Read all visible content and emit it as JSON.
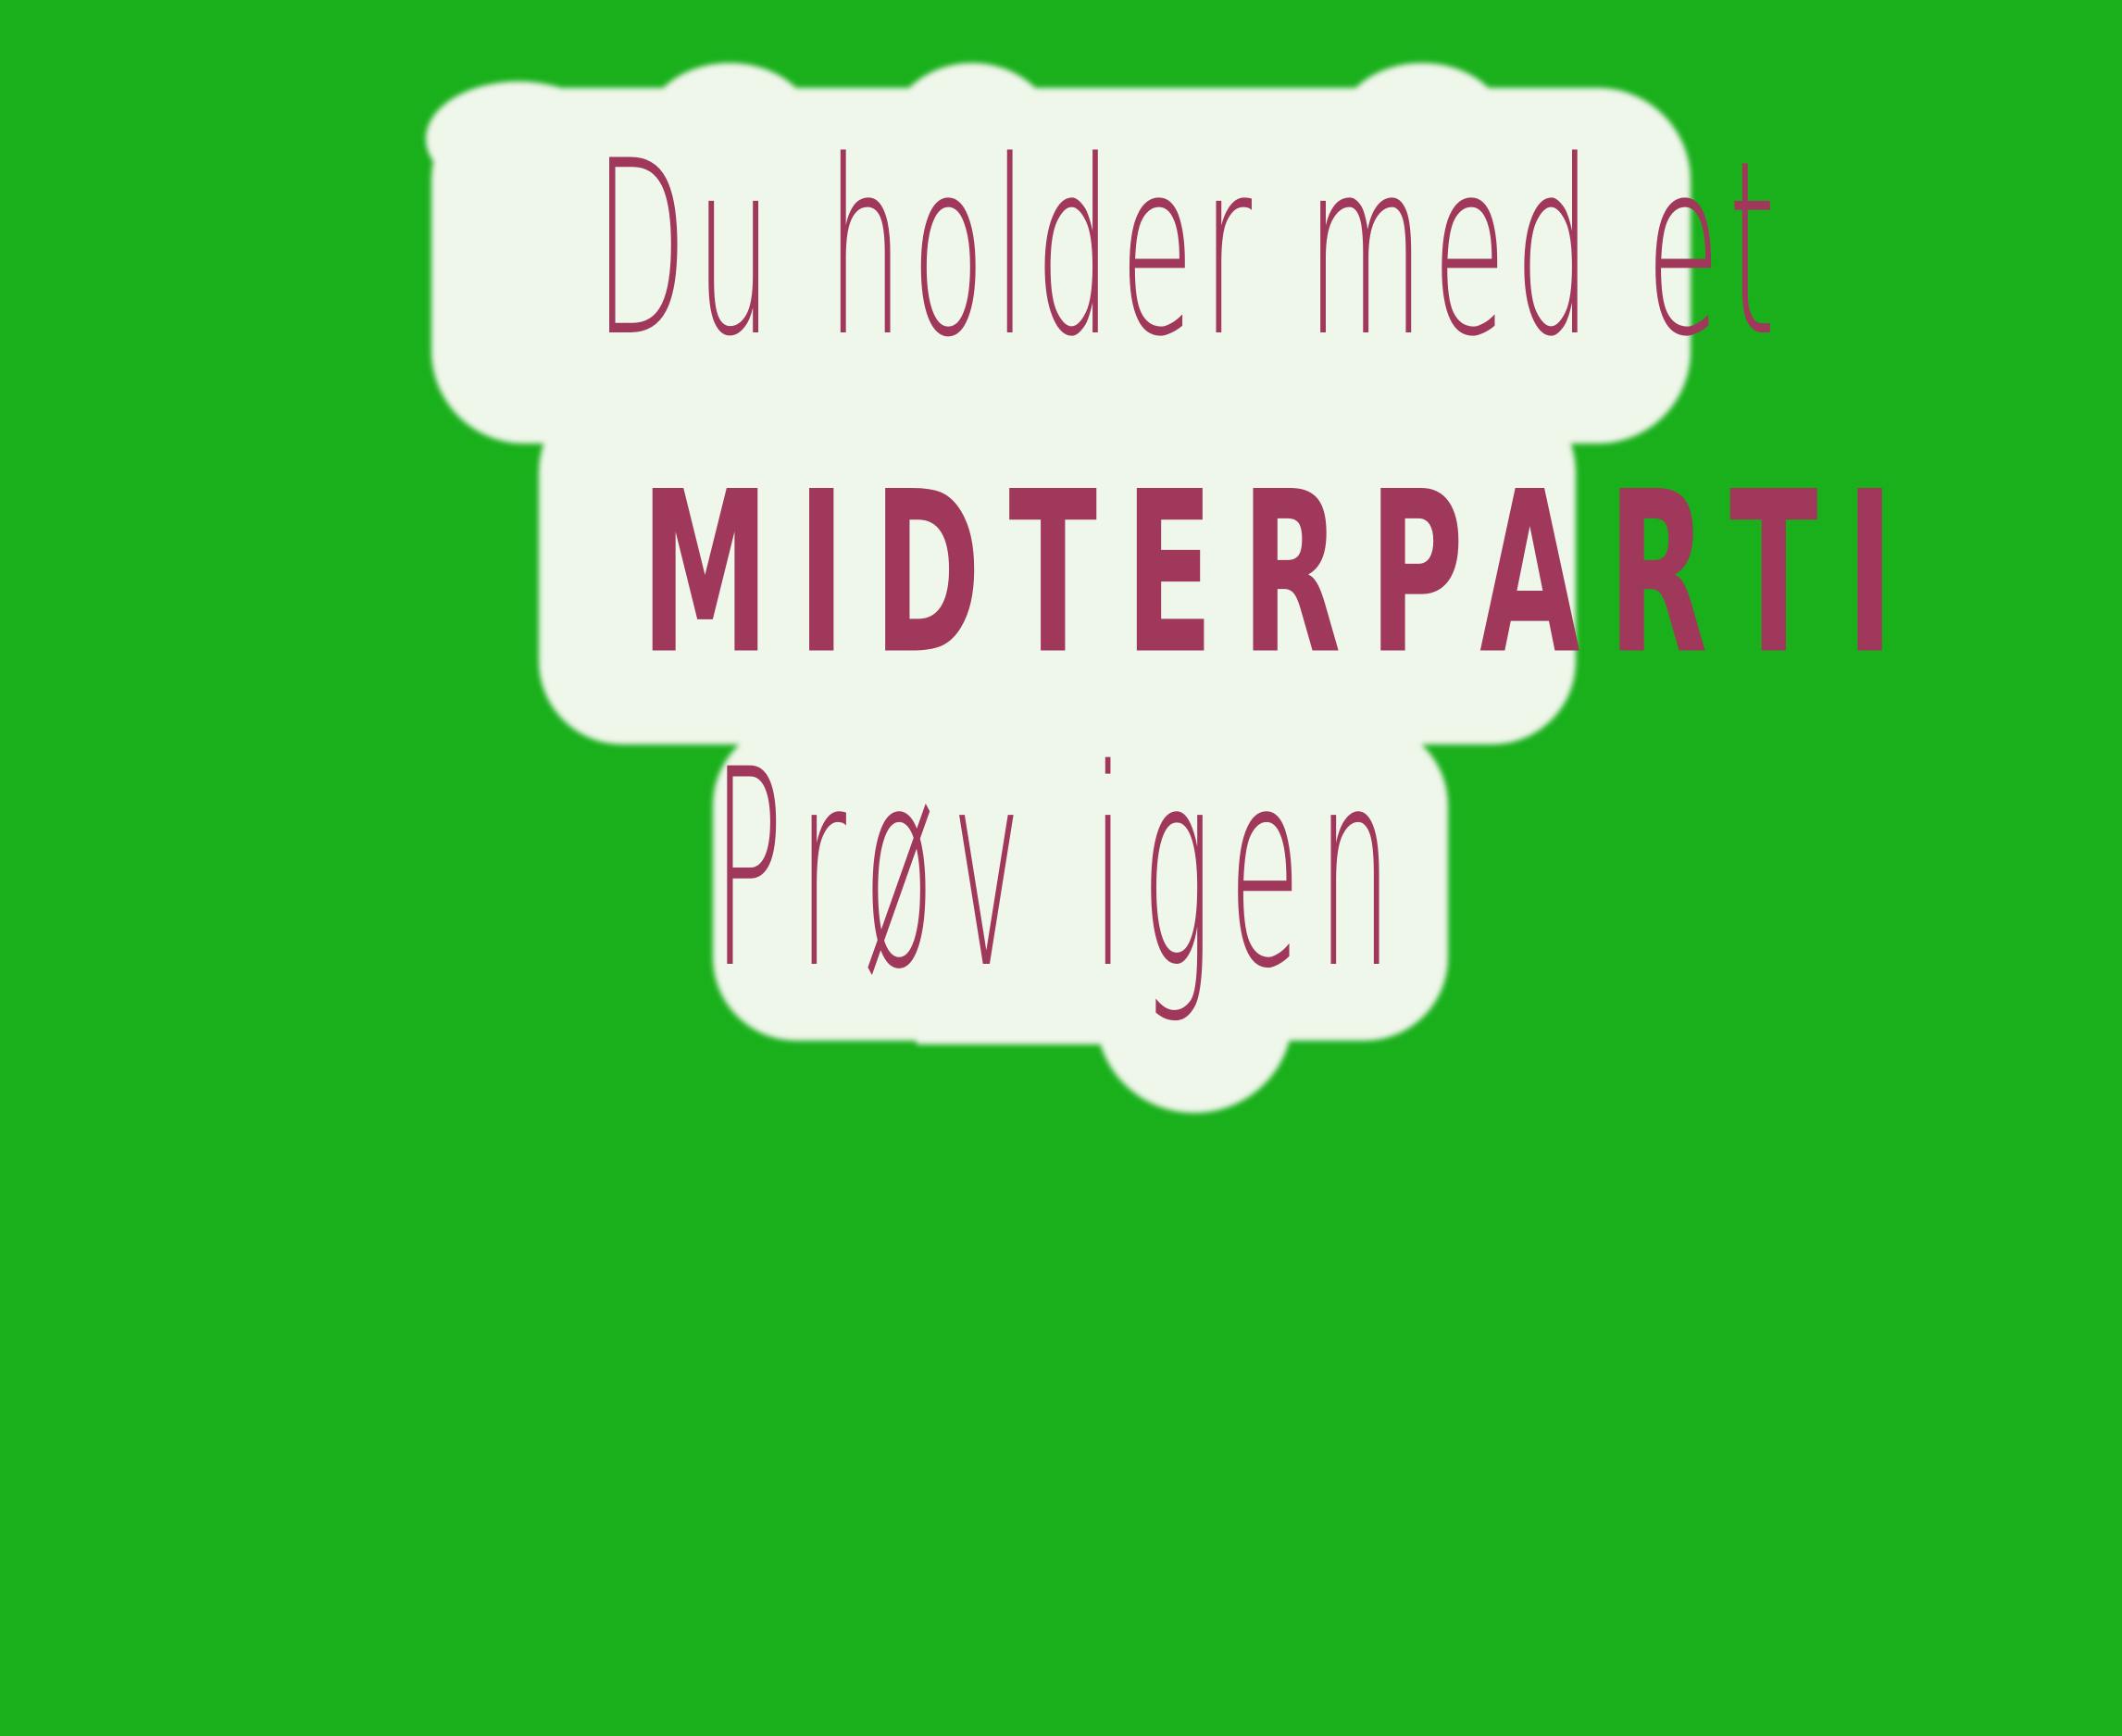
{
  "colors": {
    "background": "#1ab01c",
    "sticker": "#eff6ea",
    "text": "#a0385c"
  },
  "result": {
    "line1": "Du holder med et",
    "line2": "MIDTERPARTI",
    "line3": "Prøv igen"
  }
}
